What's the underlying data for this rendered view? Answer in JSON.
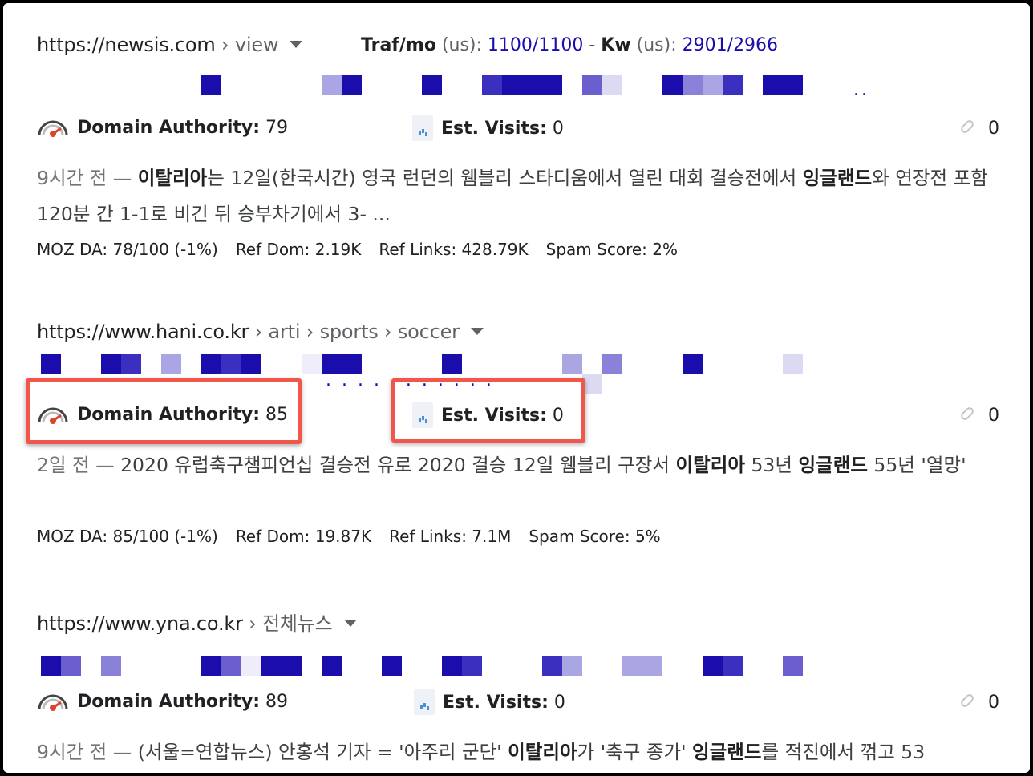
{
  "results": [
    {
      "url": "https://newsis.com",
      "crumbs": " › view",
      "traffic": {
        "label": "Traf/mo",
        "region": "(us):",
        "v1": "1100",
        "slash": "/",
        "v2": "1100",
        "dash": " - ",
        "kw_label": "Kw",
        "kw_region": "(us):",
        "k1": "2901",
        "k2": "2966"
      },
      "title_dots": "..",
      "da_label": "Domain Authority:",
      "da_value": "79",
      "visits_label": "Est. Visits:",
      "visits_value": "0",
      "links_count": "0",
      "snippet_date": "9시간 전 — ",
      "snippet_parts": [
        "이탈리아",
        "는 12일(한국시간) 영국 런던의 웸블리 스타디움에서 열린 대회 결승전에서 ",
        "잉글랜드",
        "와 연장전 포함 120분 간 1-1로 비긴 뒤 승부차기에서 3- ..."
      ],
      "moz": [
        "MOZ DA: 78/100 (-1%)",
        "Ref Dom: 2.19K",
        "Ref Links: 428.79K",
        "Spam Score: 2%"
      ]
    },
    {
      "url": "https://www.hani.co.kr",
      "crumbs": " › arti › sports › soccer",
      "title_dots": ". . .  .  .  .  .  . . . .",
      "da_label": "Domain Authority:",
      "da_value": "85",
      "visits_label": "Est. Visits:",
      "visits_value": "0",
      "links_count": "0",
      "snippet_date": "2일 전 — ",
      "snippet_parts": [
        "2020 유럽축구챔피언십 결승전 유로 2020 결승 12일 웸블리 구장서 ",
        "이탈리아",
        " 53년 ",
        "잉글랜드",
        " 55년 '열망'"
      ],
      "moz": [
        "MOZ DA: 85/100 (-1%)",
        "Ref Dom: 19.87K",
        "Ref Links: 7.1M",
        "Spam Score: 5%"
      ]
    },
    {
      "url": "https://www.yna.co.kr",
      "crumbs": " › 전체뉴스",
      "da_label": "Domain Authority:",
      "da_value": "89",
      "visits_label": "Est. Visits:",
      "visits_value": "0",
      "links_count": "0",
      "snippet_date": "9시간 전 — ",
      "snippet_parts": [
        "(서울=연합뉴스) 안홍석 기자 = '아주리 군단' ",
        "이탈리아",
        "가 '축구 종가' ",
        "잉글랜드",
        "를 적진에서 꺾고 53"
      ]
    }
  ],
  "colors": {
    "highlight": "#f0564a",
    "link_blue": "#1a0dab",
    "pixel_dark": "#1a0dab",
    "pixel_mid": "#6b5fcf",
    "pixel_light": "#aaa6e3"
  }
}
